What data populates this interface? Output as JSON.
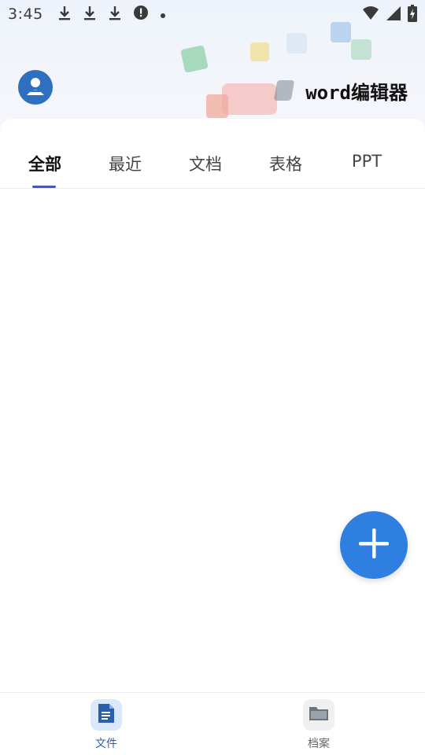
{
  "status_bar": {
    "time": "3:45",
    "icons": [
      "download-icon",
      "download-icon",
      "download-icon",
      "alert-icon",
      "dot-icon"
    ],
    "right_icons": [
      "wifi-icon",
      "signal-icon",
      "battery-icon"
    ]
  },
  "header": {
    "title": "word编辑器"
  },
  "tabs": [
    {
      "label": "全部",
      "active": true
    },
    {
      "label": "最近",
      "active": false
    },
    {
      "label": "文档",
      "active": false
    },
    {
      "label": "表格",
      "active": false
    },
    {
      "label": "PPT",
      "active": false
    }
  ],
  "fab": {
    "icon": "plus-icon"
  },
  "bottom_nav": [
    {
      "label": "文件",
      "icon": "document-icon",
      "active": true
    },
    {
      "label": "档案",
      "icon": "folder-icon",
      "active": false
    }
  ],
  "colors": {
    "accent": "#2f7fe0",
    "tab_indicator": "#4a56b8",
    "avatar": "#2f6fbf",
    "nav_active_bg": "#dbe8fb",
    "nav_inactive_bg": "#f0f0f0"
  }
}
